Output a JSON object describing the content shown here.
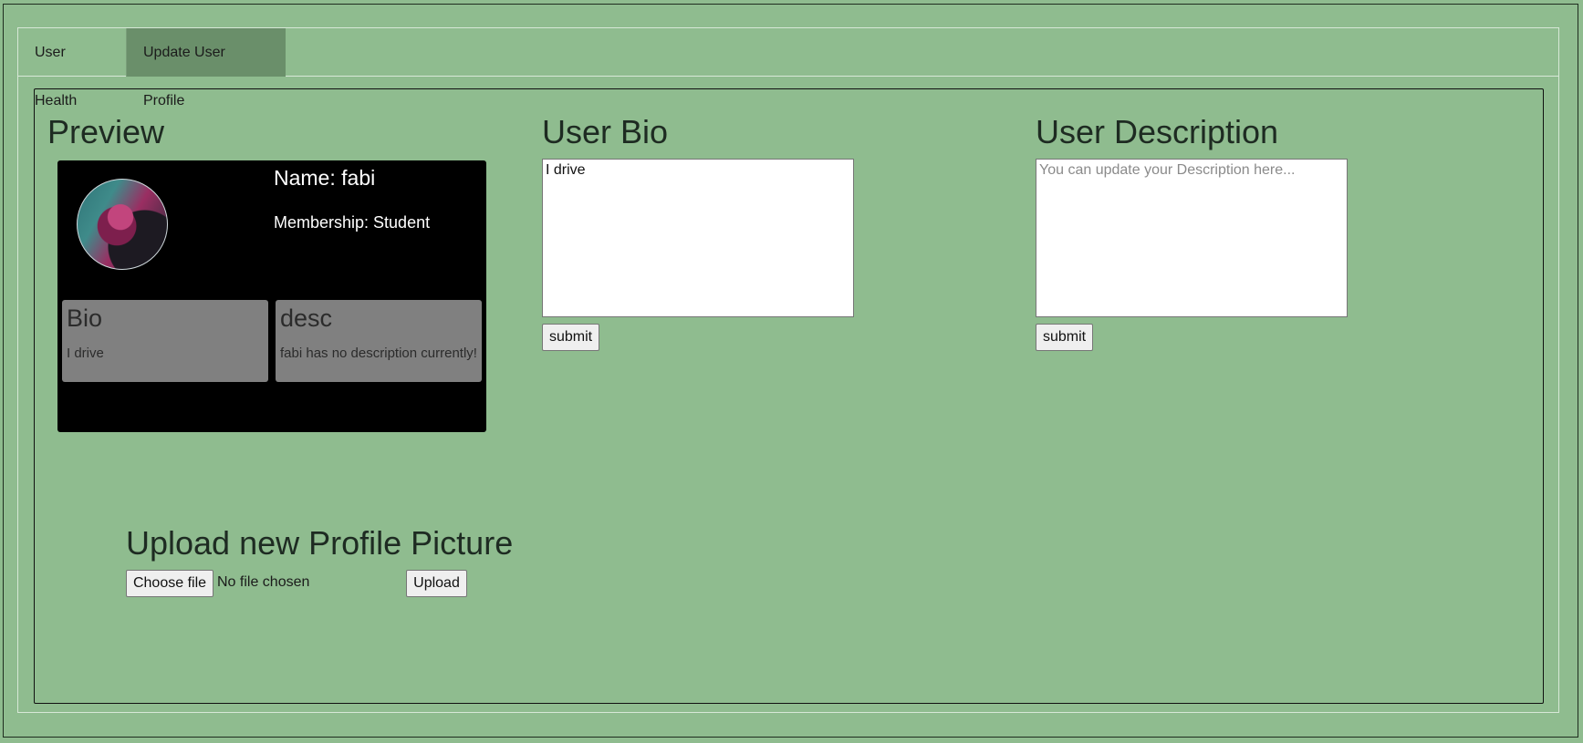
{
  "tabs": [
    {
      "label": "User Health",
      "active": false
    },
    {
      "label": "Update User Profile",
      "active": true
    }
  ],
  "preview": {
    "title": "Preview",
    "name": "Name: fabi",
    "membership": "Membership: Student",
    "bio_title": "Bio",
    "bio_text": "I drive",
    "desc_title": "desc",
    "desc_text": "fabi has no description currently!"
  },
  "user_bio": {
    "title": "User Bio",
    "value": "I drive",
    "submit_label": "submit"
  },
  "user_description": {
    "title": "User Description",
    "placeholder": "You can update your Description here...",
    "submit_label": "submit"
  },
  "upload": {
    "title": "Upload new Profile Picture",
    "choose_label": "Choose file",
    "status": "No file chosen",
    "upload_label": "Upload"
  },
  "colors": {
    "background": "#8fbc8f",
    "active_tab": "#6a8f6a",
    "card": "#000000",
    "mini_card": "#808080"
  }
}
